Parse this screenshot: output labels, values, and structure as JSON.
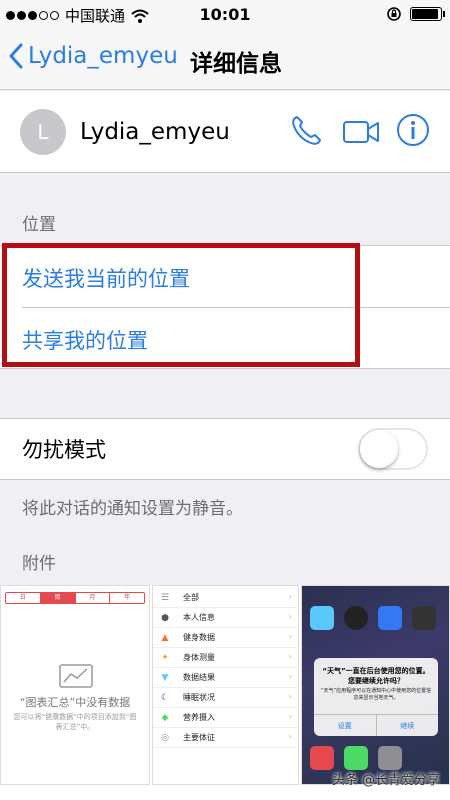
{
  "status_bar": {
    "carrier": "中国联通",
    "time": "10:01",
    "battery_level": 0.92
  },
  "nav": {
    "back_label": "Lydia_emyeu",
    "title": "详细信息"
  },
  "contact": {
    "avatar_initial": "L",
    "name": "Lydia_emyeu"
  },
  "location": {
    "header": "位置",
    "send_current": "发送我当前的位置",
    "share": "共享我的位置"
  },
  "dnd": {
    "label": "勿扰模式",
    "enabled": false,
    "note": "将此对话的通知设置为静音。"
  },
  "attachments": {
    "header": "附件",
    "thumb1": {
      "segments": [
        "日",
        "周",
        "月",
        "年"
      ],
      "active_segment": 1,
      "empty_title": "“图表汇总”中没有数据",
      "empty_desc": "您可以将“健康数据”中的项目添加到“图表汇总”中。"
    },
    "thumb2": {
      "items": [
        {
          "label": "全部",
          "icon": "list-icon",
          "color": "#8e8e93"
        },
        {
          "label": "本人信息",
          "icon": "person-icon",
          "color": "#555555"
        },
        {
          "label": "健身数据",
          "icon": "flame-icon",
          "color": "#ff6b2c"
        },
        {
          "label": "身体测量",
          "icon": "figure-icon",
          "color": "#f5a623"
        },
        {
          "label": "数据结果",
          "icon": "flask-icon",
          "color": "#5ac8fa"
        },
        {
          "label": "睡眠状况",
          "icon": "moon-icon",
          "color": "#3b3b98"
        },
        {
          "label": "营养摄入",
          "icon": "carrot-icon",
          "color": "#4cd964"
        },
        {
          "label": "主要体征",
          "icon": "stethoscope-icon",
          "color": "#8e8e93"
        }
      ]
    },
    "thumb3": {
      "alert_title": "“天气”一直在后台使用您的位置。您要继续允许吗？",
      "alert_body": "“天气”应用程序可以在通知中心中使用您的位置信息来显示当地天气。",
      "settings_btn": "设置",
      "continue_btn": "继续"
    }
  },
  "watermark": "头条 @长青爱分享",
  "colors": {
    "accent": "#2a7de1",
    "highlight_border": "#b30f12"
  }
}
